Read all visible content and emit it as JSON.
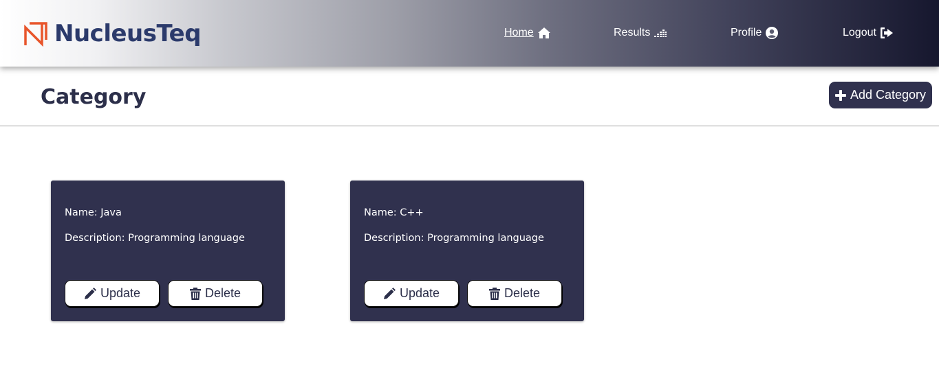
{
  "header": {
    "logo_text": "NucleusTeq",
    "nav": [
      {
        "label": "Home",
        "icon": "home-icon",
        "active": true
      },
      {
        "label": "Results",
        "icon": "results-chart-icon",
        "active": false
      },
      {
        "label": "Profile",
        "icon": "user-circle-icon",
        "active": false
      },
      {
        "label": "Logout",
        "icon": "sign-out-icon",
        "active": false
      }
    ],
    "colors": {
      "gradient_start": "#ffffff",
      "gradient_end": "#16172e",
      "logo_text": "#2b3a6b",
      "logo_mark": "#e8552b"
    }
  },
  "page": {
    "title": "Category",
    "add_button_label": "Add Category",
    "add_button_icon": "plus-icon"
  },
  "categories": [
    {
      "name_line": "Name: Java",
      "description_line": "Description: Programming language",
      "update_label": "Update",
      "delete_label": "Delete"
    },
    {
      "name_line": "Name: C++",
      "description_line": "Description: Programming language",
      "update_label": "Update",
      "delete_label": "Delete"
    }
  ],
  "colors": {
    "card_bg": "#30314e",
    "button_bg": "#ffffff",
    "title": "#2c2f4a"
  }
}
